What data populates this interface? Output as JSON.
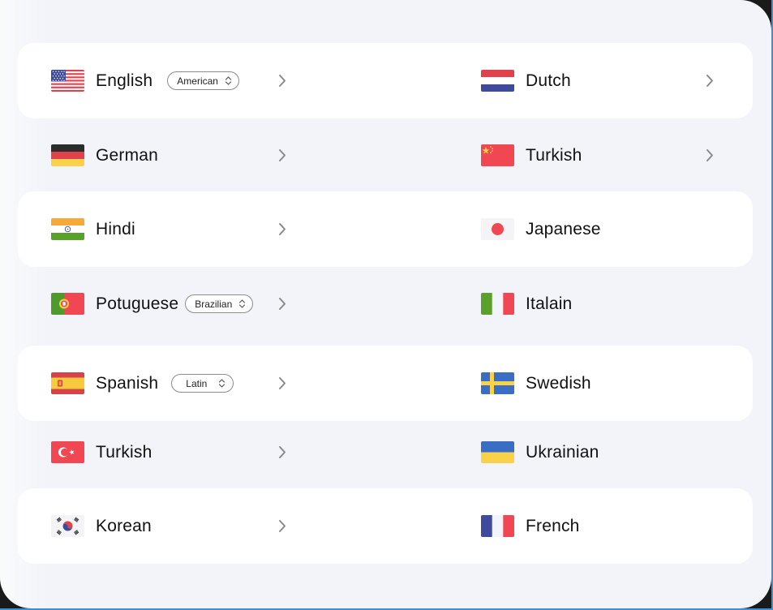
{
  "rows": [
    {
      "left": {
        "name": "English",
        "flag": "us-flag",
        "variant": "American",
        "has_chevron": true
      },
      "right": {
        "name": "Dutch",
        "flag": "netherlands-flag",
        "has_chevron": true
      }
    },
    {
      "left": {
        "name": "German",
        "flag": "germany-flag",
        "has_chevron": true
      },
      "right": {
        "name": "Turkish",
        "flag": "china-flag",
        "has_chevron": true
      }
    },
    {
      "left": {
        "name": "Hindi",
        "flag": "india-flag",
        "has_chevron": true
      },
      "right": {
        "name": "Japanese",
        "flag": "japan-flag",
        "has_chevron": false
      }
    },
    {
      "left": {
        "name": "Potuguese",
        "flag": "portugal-flag",
        "variant": "Brazilian",
        "has_chevron": true
      },
      "right": {
        "name": "Italain",
        "flag": "italy-flag",
        "has_chevron": false
      }
    },
    {
      "left": {
        "name": "Spanish",
        "flag": "spain-flag",
        "variant": "Latin",
        "has_chevron": true
      },
      "right": {
        "name": "Swedish",
        "flag": "sweden-flag",
        "has_chevron": false
      }
    },
    {
      "left": {
        "name": "Turkish",
        "flag": "turkey-flag",
        "has_chevron": true
      },
      "right": {
        "name": "Ukrainian",
        "flag": "ukraine-flag",
        "has_chevron": false
      }
    },
    {
      "left": {
        "name": "Korean",
        "flag": "korea-flag",
        "has_chevron": true
      },
      "right": {
        "name": "French",
        "flag": "france-flag",
        "has_chevron": false
      }
    }
  ],
  "colors": {
    "panel_bg": "#f3f4f9",
    "row_highlight": "#ffffff",
    "chevron": "#8a8a8a",
    "accent_border": "#3d8fd6"
  }
}
